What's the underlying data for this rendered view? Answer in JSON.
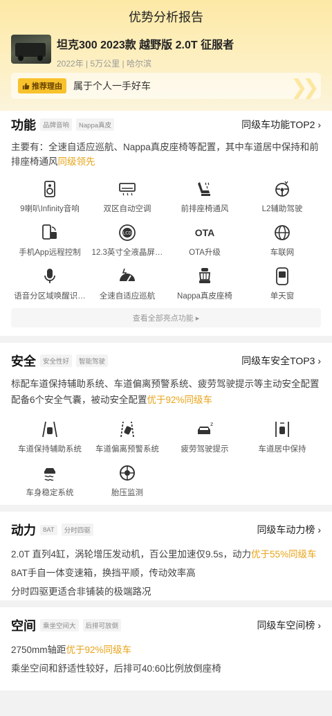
{
  "page": {
    "title": "优势分析报告"
  },
  "car": {
    "name": "坦克300 2023款 越野版 2.0T 征服者",
    "meta": "2022年 | 5万公里 | 哈尔滨"
  },
  "reason": {
    "tag": "推荐理由",
    "text": "属于个人一手好车"
  },
  "function": {
    "title": "功能",
    "tags": [
      "品牌音响",
      "Nappa真皮"
    ],
    "rank": "同级车功能TOP2",
    "desc_pre": "主要有：全速自适应巡航、Nappa真皮座椅等配置，其中车道居中保持和前排座椅通风",
    "desc_hl": "同级领先",
    "items": [
      {
        "label": "9喇叭Infinity音响",
        "icon": "speaker-icon"
      },
      {
        "label": "双区自动空调",
        "icon": "air-conditioner-icon"
      },
      {
        "label": "前排座椅通风",
        "icon": "seat-ventilation-icon"
      },
      {
        "label": "L2辅助驾驶",
        "icon": "steering-assist-icon"
      },
      {
        "label": "手机App远程控制",
        "icon": "phone-remote-icon"
      },
      {
        "label": "12.3英寸全液晶屏…",
        "icon": "lcd-gauge-icon"
      },
      {
        "label": "OTA升级",
        "icon": "ota-icon"
      },
      {
        "label": "车联网",
        "icon": "globe-icon"
      },
      {
        "label": "语音分区域唤醒识…",
        "icon": "microphone-icon"
      },
      {
        "label": "全速自适应巡航",
        "icon": "cruise-gauge-icon"
      },
      {
        "label": "Nappa真皮座椅",
        "icon": "leather-seat-icon"
      },
      {
        "label": "单天窗",
        "icon": "sunroof-icon"
      }
    ],
    "more": "查看全部亮点功能 ▸"
  },
  "safety": {
    "title": "安全",
    "tags": [
      "安全性好",
      "智能驾驶"
    ],
    "rank": "同级车安全TOP3",
    "desc_line1": "标配车道保持辅助系统、车道偏离预警系统、疲劳驾驶提示等主动安全配置",
    "desc_line2_pre": "配备6个安全气囊，被动安全配置",
    "desc_line2_hl": "优于92%同级车",
    "items": [
      {
        "label": "车道保持辅助系统",
        "icon": "lane-keep-icon"
      },
      {
        "label": "车道偏离预警系统",
        "icon": "lane-departure-icon"
      },
      {
        "label": "疲劳驾驶提示",
        "icon": "fatigue-alert-icon"
      },
      {
        "label": "车道居中保持",
        "icon": "lane-center-icon"
      },
      {
        "label": "车身稳定系统",
        "icon": "stability-icon"
      },
      {
        "label": "胎压监测",
        "icon": "tire-pressure-icon"
      }
    ]
  },
  "power": {
    "title": "动力",
    "tags": [
      "8AT",
      "分时四驱"
    ],
    "rank": "同级车动力榜",
    "line1_pre": "2.0T 直列4缸，涡轮增压发动机，百公里加速仅9.5s，动力",
    "line1_hl": "优于55%同级车",
    "line2": "8AT手自一体变速箱，换挡平顺，传动效率高",
    "line3": "分时四驱更适合非铺装的极端路况"
  },
  "space": {
    "title": "空间",
    "tags": [
      "乘坐空间大",
      "后排可放倒"
    ],
    "rank": "同级车空间榜",
    "line1_pre": "2750mm轴距",
    "line1_hl": "优于92%同级车",
    "line2": "乘坐空间和舒适性较好，后排可40:60比例放倒座椅"
  },
  "colors": {
    "accent": "#e8a317",
    "tag_yellow": "#f8c22d",
    "header_bg": "#fde9a6"
  }
}
